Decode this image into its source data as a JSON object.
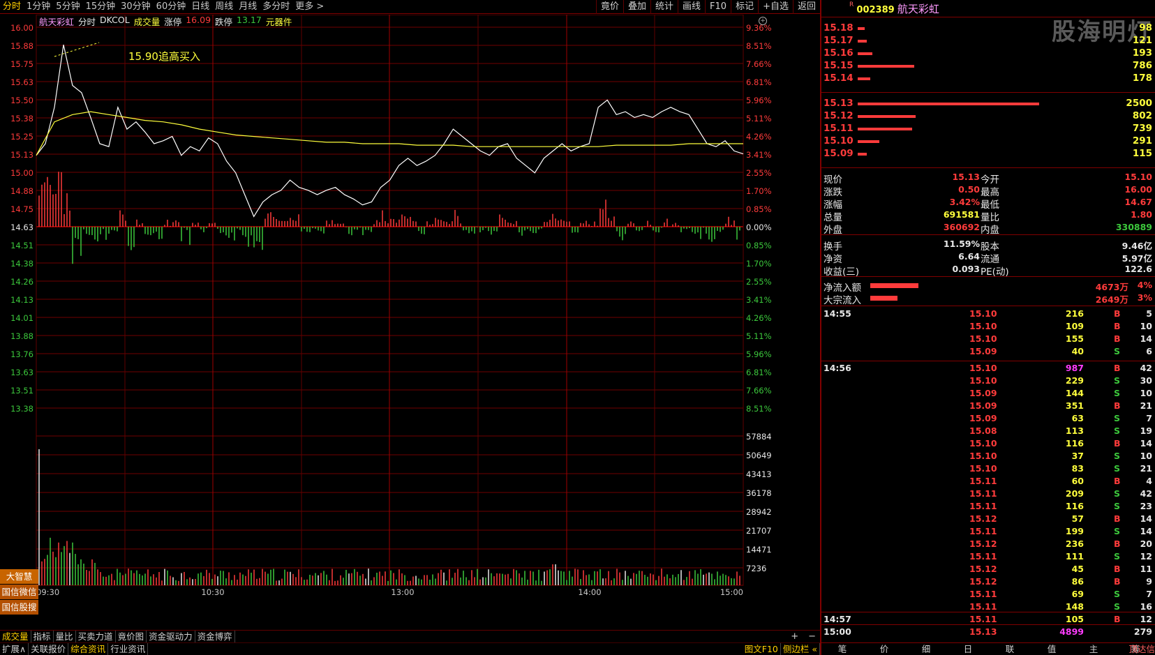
{
  "period_tabs": [
    {
      "label": "分时",
      "active": true
    },
    {
      "label": "1分钟"
    },
    {
      "label": "5分钟"
    },
    {
      "label": "15分钟"
    },
    {
      "label": "30分钟"
    },
    {
      "label": "60分钟"
    },
    {
      "label": "日线"
    },
    {
      "label": "周线"
    },
    {
      "label": "月线"
    },
    {
      "label": "多分时"
    },
    {
      "label": "更多 >"
    }
  ],
  "toolbar": [
    "竟价",
    "叠加",
    "统计",
    "画线",
    "F10",
    "标记",
    "+自选",
    "返回"
  ],
  "chart_header": {
    "name": "航天彩虹",
    "mode": "分时",
    "indicator": "DKCOL",
    "volume": "成交量",
    "limit_up_label": "涨停",
    "limit_up": "16.09",
    "limit_down_label": "跌停",
    "limit_down": "13.17",
    "sector": "元器件"
  },
  "annotation": "15.90追高买入",
  "price_axis": [
    "16.00",
    "15.88",
    "15.75",
    "15.63",
    "15.50",
    "15.38",
    "15.25",
    "15.13",
    "15.00",
    "14.88",
    "14.75",
    "14.63",
    "14.51",
    "14.38",
    "14.26",
    "14.13",
    "14.01",
    "13.88",
    "13.76",
    "13.63",
    "13.51",
    "13.38"
  ],
  "pct_axis": [
    "9.36%",
    "8.51%",
    "7.66%",
    "6.81%",
    "5.96%",
    "5.11%",
    "4.26%",
    "3.41%",
    "2.55%",
    "1.70%",
    "0.85%",
    "0.00%",
    "0.85%",
    "1.70%",
    "2.55%",
    "3.41%",
    "4.26%",
    "5.11%",
    "5.96%",
    "6.81%",
    "7.66%",
    "8.51%"
  ],
  "vol_axis": [
    "57884",
    "50649",
    "43413",
    "36178",
    "28942",
    "21707",
    "14471",
    "7236"
  ],
  "time_axis": [
    "09:30",
    "10:30",
    "13:00",
    "14:00",
    "15:00"
  ],
  "side_badges": [
    "大智慧",
    "国信微信",
    "国信股搜"
  ],
  "bottom_tabs": [
    {
      "label": "成交量",
      "active": true
    },
    {
      "label": "指标"
    },
    {
      "label": "量比"
    },
    {
      "label": "买卖力道"
    },
    {
      "label": "竟价图"
    },
    {
      "label": "资金驱动力"
    },
    {
      "label": "资金博弈"
    }
  ],
  "bottom_tabs2": [
    {
      "label": "扩展∧"
    },
    {
      "label": "关联报价"
    },
    {
      "label": "综合资讯",
      "active": true
    },
    {
      "label": "行业资讯"
    }
  ],
  "bottom_right": [
    "图文F10",
    "侧边栏 «"
  ],
  "plus_minus": [
    "+",
    "−"
  ],
  "stock": {
    "flag": "R",
    "code": "002389",
    "name": "航天彩虹"
  },
  "watermark": "股海明灯",
  "asks": [
    {
      "price": "15.18",
      "vol": "98",
      "frac": 0.04
    },
    {
      "price": "15.17",
      "vol": "121",
      "frac": 0.05
    },
    {
      "price": "15.16",
      "vol": "193",
      "frac": 0.08
    },
    {
      "price": "15.15",
      "vol": "786",
      "frac": 0.31
    },
    {
      "price": "15.14",
      "vol": "178",
      "frac": 0.07
    }
  ],
  "bids": [
    {
      "price": "15.13",
      "vol": "2500",
      "frac": 1.0
    },
    {
      "price": "15.12",
      "vol": "802",
      "frac": 0.32
    },
    {
      "price": "15.11",
      "vol": "739",
      "frac": 0.3
    },
    {
      "price": "15.10",
      "vol": "291",
      "frac": 0.12
    },
    {
      "price": "15.09",
      "vol": "115",
      "frac": 0.05
    }
  ],
  "quote": [
    [
      {
        "label": "现价",
        "value": "15.13",
        "color": "red"
      },
      {
        "label": "今开",
        "value": "15.10",
        "color": "red"
      }
    ],
    [
      {
        "label": "涨跌",
        "value": "0.50",
        "color": "red"
      },
      {
        "label": "最高",
        "value": "16.00",
        "color": "red"
      }
    ],
    [
      {
        "label": "涨幅",
        "value": "3.42%",
        "color": "red"
      },
      {
        "label": "最低",
        "value": "14.67",
        "color": "red"
      }
    ],
    [
      {
        "label": "总量",
        "value": "691581",
        "color": "yellow"
      },
      {
        "label": "量比",
        "value": "1.80",
        "color": "red"
      }
    ],
    [
      {
        "label": "外盘",
        "value": "360692",
        "color": "red"
      },
      {
        "label": "内盘",
        "value": "330889",
        "color": "green"
      }
    ]
  ],
  "quote2": [
    [
      {
        "label": "换手",
        "value": "11.59%",
        "color": "white"
      },
      {
        "label": "股本",
        "value": "9.46亿",
        "color": "white"
      }
    ],
    [
      {
        "label": "净资",
        "value": "6.64",
        "color": "white"
      },
      {
        "label": "流通",
        "value": "5.97亿",
        "color": "white"
      }
    ],
    [
      {
        "label": "收益(三)",
        "value": "0.093",
        "color": "white"
      },
      {
        "label": "PE(动)",
        "value": "122.6",
        "color": "white"
      }
    ]
  ],
  "flows": [
    {
      "label": "净流入额",
      "value": "4673万",
      "pct": "4%",
      "frac": 0.6
    },
    {
      "label": "大宗流入",
      "value": "2649万",
      "pct": "3%",
      "frac": 0.34
    }
  ],
  "ticks": [
    {
      "time": "14:55",
      "price": "15.10",
      "vol": "216",
      "side": "B",
      "n": "5"
    },
    {
      "time": "",
      "price": "15.10",
      "vol": "109",
      "side": "B",
      "n": "10"
    },
    {
      "time": "",
      "price": "15.10",
      "vol": "155",
      "side": "B",
      "n": "14"
    },
    {
      "time": "",
      "price": "15.09",
      "vol": "40",
      "side": "S",
      "n": "6"
    },
    {
      "time": "14:56",
      "price": "15.10",
      "vol": "987",
      "side": "B",
      "n": "42",
      "big": true
    },
    {
      "time": "",
      "price": "15.10",
      "vol": "229",
      "side": "S",
      "n": "30"
    },
    {
      "time": "",
      "price": "15.09",
      "vol": "144",
      "side": "S",
      "n": "10"
    },
    {
      "time": "",
      "price": "15.09",
      "vol": "351",
      "side": "B",
      "n": "21"
    },
    {
      "time": "",
      "price": "15.09",
      "vol": "63",
      "side": "S",
      "n": "7"
    },
    {
      "time": "",
      "price": "15.08",
      "vol": "113",
      "side": "S",
      "n": "19"
    },
    {
      "time": "",
      "price": "15.10",
      "vol": "116",
      "side": "B",
      "n": "14"
    },
    {
      "time": "",
      "price": "15.10",
      "vol": "37",
      "side": "S",
      "n": "10"
    },
    {
      "time": "",
      "price": "15.10",
      "vol": "83",
      "side": "S",
      "n": "21"
    },
    {
      "time": "",
      "price": "15.11",
      "vol": "60",
      "side": "B",
      "n": "4"
    },
    {
      "time": "",
      "price": "15.11",
      "vol": "209",
      "side": "S",
      "n": "42"
    },
    {
      "time": "",
      "price": "15.11",
      "vol": "116",
      "side": "S",
      "n": "23"
    },
    {
      "time": "",
      "price": "15.12",
      "vol": "57",
      "side": "B",
      "n": "14"
    },
    {
      "time": "",
      "price": "15.11",
      "vol": "199",
      "side": "S",
      "n": "14"
    },
    {
      "time": "",
      "price": "15.12",
      "vol": "236",
      "side": "B",
      "n": "20"
    },
    {
      "time": "",
      "price": "15.11",
      "vol": "111",
      "side": "S",
      "n": "12"
    },
    {
      "time": "",
      "price": "15.12",
      "vol": "45",
      "side": "B",
      "n": "11"
    },
    {
      "time": "",
      "price": "15.12",
      "vol": "86",
      "side": "B",
      "n": "9"
    },
    {
      "time": "",
      "price": "15.11",
      "vol": "69",
      "side": "S",
      "n": "7"
    },
    {
      "time": "",
      "price": "15.11",
      "vol": "148",
      "side": "S",
      "n": "16"
    },
    {
      "time": "14:57",
      "price": "15.11",
      "vol": "105",
      "side": "B",
      "n": "12"
    },
    {
      "time": "15:00",
      "price": "15.13",
      "vol": "4899",
      "side": "",
      "n": "279",
      "big": true
    }
  ],
  "right_bottom_tabs": [
    "笔",
    "价",
    "细",
    "日",
    "联",
    "值",
    "主",
    "筹"
  ],
  "right_bottom_extra": "顶达信",
  "chart_data": {
    "type": "line",
    "series": [
      {
        "values": [
          15.12,
          15.2,
          15.45,
          15.88,
          15.6,
          15.55,
          15.38,
          15.2,
          15.18,
          15.45,
          15.3,
          15.35,
          15.28,
          15.2,
          15.22,
          15.25,
          15.12,
          15.18,
          15.15,
          15.24,
          15.2,
          15.08,
          15.0,
          14.85,
          14.7,
          14.8,
          14.85,
          14.88,
          14.95,
          14.9,
          14.88,
          14.85,
          14.88,
          14.9,
          14.85,
          14.82,
          14.78,
          14.8,
          14.9,
          14.95,
          15.05,
          15.1,
          15.05,
          15.08,
          15.12,
          15.2,
          15.3,
          15.25,
          15.2,
          15.15,
          15.12,
          15.18,
          15.2,
          15.1,
          15.05,
          15.0,
          15.1,
          15.15,
          15.2,
          15.15,
          15.18,
          15.2,
          15.45,
          15.5,
          15.4,
          15.42,
          15.38,
          15.4,
          15.38,
          15.42,
          15.45,
          15.42,
          15.4,
          15.3,
          15.2,
          15.18,
          15.22,
          15.15,
          15.13
        ]
      },
      {
        "values": [
          15.12,
          15.35,
          15.4,
          15.42,
          15.4,
          15.38,
          15.36,
          15.35,
          15.33,
          15.3,
          15.28,
          15.26,
          15.25,
          15.24,
          15.23,
          15.22,
          15.21,
          15.21,
          15.2,
          15.2,
          15.2,
          15.19,
          15.19,
          15.19,
          15.18,
          15.18,
          15.18,
          15.18,
          15.18,
          15.18,
          15.18,
          15.18,
          15.19,
          15.19,
          15.19,
          15.19,
          15.2,
          15.2,
          15.2,
          15.2
        ]
      }
    ],
    "ylim": [
      13.26,
      16.0
    ],
    "prev_close": 14.63
  }
}
